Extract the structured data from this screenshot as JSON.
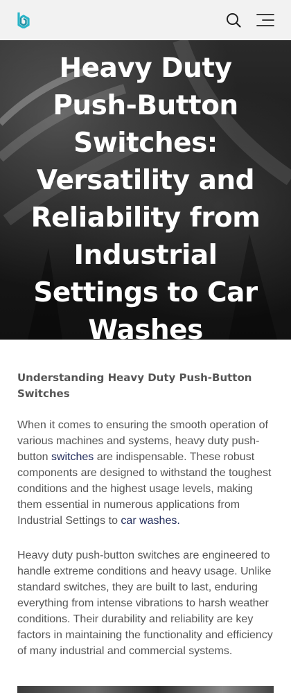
{
  "header": {
    "logo_icon": "brand-logo-icon",
    "search_icon": "search-icon",
    "menu_icon": "hamburger-menu-icon",
    "accent_color": "#2bb5c8"
  },
  "hero": {
    "title": "Heavy Duty Push-Button Switches: Versatility and Reliability from Industrial Settings to Car Washes"
  },
  "article": {
    "heading": "Understanding Heavy Duty Push-Button Switches",
    "p1": {
      "before_link1": "When it comes to ensuring the smooth operation of various machines and systems, heavy duty push-button ",
      "link1": "switches",
      "between_links": " are indispensable. These robust components are designed to withstand the toughest conditions and the highest usage levels, making them essential in numerous applications from Industrial Settings to ",
      "link2": "car washes."
    },
    "p2": "Heavy duty push-button switches are engineered to handle extreme conditions and heavy usage. Unlike standard switches, they are built to last, enduring everything from intense vibrations to harsh weather conditions. Their durability and reliability are key factors in maintaining the functionality and efficiency of many industrial and commercial systems."
  }
}
